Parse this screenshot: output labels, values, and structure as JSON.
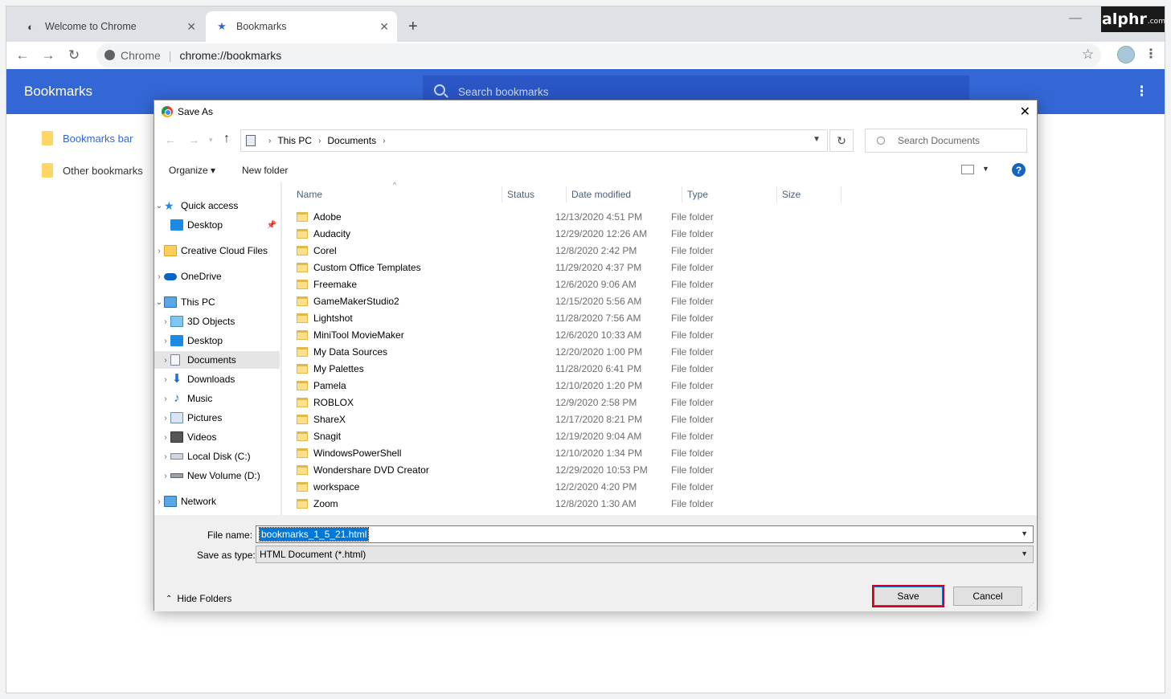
{
  "browser": {
    "tabs": [
      {
        "label": "Welcome to Chrome"
      },
      {
        "label": "Bookmarks"
      }
    ],
    "omnibox": {
      "site": "Chrome",
      "url": "chrome://bookmarks"
    },
    "watermark": "alphr",
    "watermark_suffix": ".com"
  },
  "bookmarks_page": {
    "title": "Bookmarks",
    "search_placeholder": "Search bookmarks",
    "nav": [
      {
        "label": "Bookmarks bar"
      },
      {
        "label": "Other bookmarks"
      }
    ]
  },
  "dialog": {
    "title": "Save As",
    "breadcrumb": [
      "This PC",
      "Documents"
    ],
    "search_placeholder": "Search Documents",
    "organize_label": "Organize",
    "new_folder_label": "New folder",
    "tree": [
      {
        "label": "Quick access",
        "expanded": true
      },
      {
        "label": "Desktop",
        "pinned": true
      },
      {
        "label": "Creative Cloud Files"
      },
      {
        "label": "OneDrive"
      },
      {
        "label": "This PC",
        "expanded": true
      },
      {
        "label": "3D Objects"
      },
      {
        "label": "Desktop"
      },
      {
        "label": "Documents",
        "selected": true
      },
      {
        "label": "Downloads"
      },
      {
        "label": "Music"
      },
      {
        "label": "Pictures"
      },
      {
        "label": "Videos"
      },
      {
        "label": "Local Disk (C:)"
      },
      {
        "label": "New Volume (D:)"
      },
      {
        "label": "Network"
      }
    ],
    "columns": [
      "Name",
      "Status",
      "Date modified",
      "Type",
      "Size"
    ],
    "files": [
      {
        "name": "Adobe",
        "date": "12/13/2020 4:51 PM",
        "type": "File folder"
      },
      {
        "name": "Audacity",
        "date": "12/29/2020 12:26 AM",
        "type": "File folder"
      },
      {
        "name": "Corel",
        "date": "12/8/2020 2:42 PM",
        "type": "File folder"
      },
      {
        "name": "Custom Office Templates",
        "date": "11/29/2020 4:37 PM",
        "type": "File folder"
      },
      {
        "name": "Freemake",
        "date": "12/6/2020 9:06 AM",
        "type": "File folder"
      },
      {
        "name": "GameMakerStudio2",
        "date": "12/15/2020 5:56 AM",
        "type": "File folder"
      },
      {
        "name": "Lightshot",
        "date": "11/28/2020 7:56 AM",
        "type": "File folder"
      },
      {
        "name": "MiniTool MovieMaker",
        "date": "12/6/2020 10:33 AM",
        "type": "File folder"
      },
      {
        "name": "My Data Sources",
        "date": "12/20/2020 1:00 PM",
        "type": "File folder"
      },
      {
        "name": "My Palettes",
        "date": "11/28/2020 6:41 PM",
        "type": "File folder"
      },
      {
        "name": "Pamela",
        "date": "12/10/2020 1:20 PM",
        "type": "File folder"
      },
      {
        "name": "ROBLOX",
        "date": "12/9/2020 2:58 PM",
        "type": "File folder"
      },
      {
        "name": "ShareX",
        "date": "12/17/2020 8:21 PM",
        "type": "File folder"
      },
      {
        "name": "Snagit",
        "date": "12/19/2020 9:04 AM",
        "type": "File folder"
      },
      {
        "name": "WindowsPowerShell",
        "date": "12/10/2020 1:34 PM",
        "type": "File folder"
      },
      {
        "name": "Wondershare DVD Creator",
        "date": "12/29/2020 10:53 PM",
        "type": "File folder"
      },
      {
        "name": "workspace",
        "date": "12/2/2020 4:20 PM",
        "type": "File folder"
      },
      {
        "name": "Zoom",
        "date": "12/8/2020 1:30 AM",
        "type": "File folder"
      }
    ],
    "file_name_label": "File name:",
    "file_name_value": "bookmarks_1_5_21.html",
    "save_type_label": "Save as type:",
    "save_type_value": "HTML Document (*.html)",
    "hide_folders_label": "Hide Folders",
    "save_label": "Save",
    "cancel_label": "Cancel"
  },
  "colors": {
    "bookmarks_header": "#3367d6",
    "save_highlight": "#d0021b",
    "selection": "#0078d7"
  }
}
